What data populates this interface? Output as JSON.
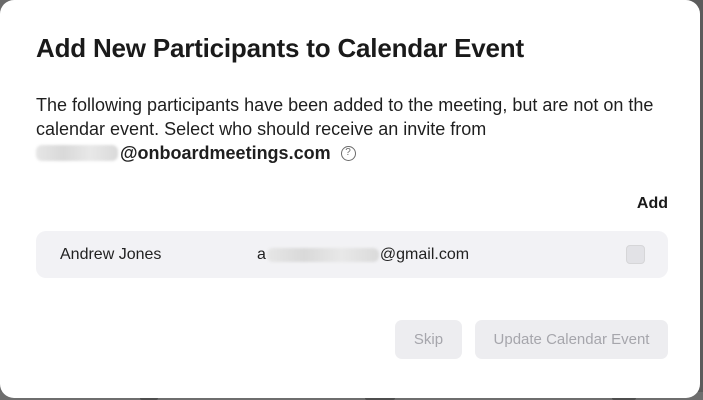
{
  "dialog": {
    "title": "Add New Participants to Calendar Event",
    "description": "The following participants have been added to the meeting, but are not on the calendar event. Select who should receive an invite from",
    "sender_domain": "@onboardmeetings.com",
    "help_icon": "question-circle-icon",
    "add_column_label": "Add"
  },
  "participants": [
    {
      "name": "Andrew Jones",
      "email_prefix": "a",
      "email_domain": "@gmail.com",
      "add_checked": false
    }
  ],
  "buttons": {
    "skip_label": "Skip",
    "update_label": "Update Calendar Event"
  },
  "colors": {
    "modal_background": "#ffffff",
    "row_background": "#f2f2f5",
    "disabled_button_background": "#ededf0",
    "disabled_button_text": "#a6a6ac",
    "overlay": "#5c5c5c"
  }
}
